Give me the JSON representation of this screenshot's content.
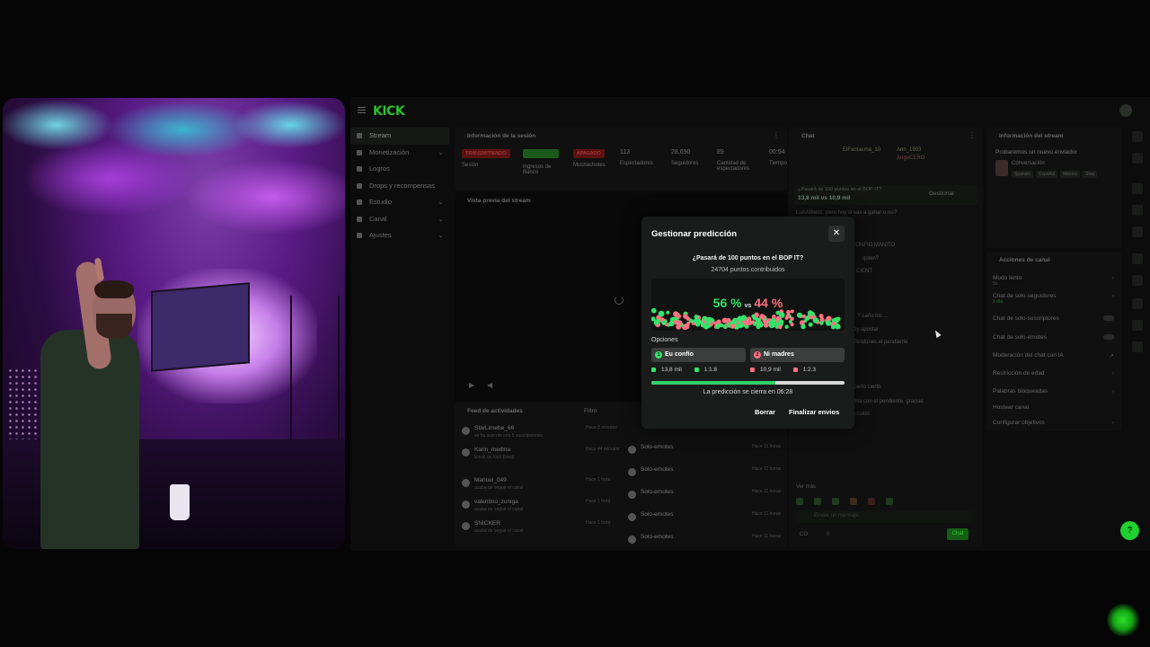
{
  "app": {
    "logo": "KICK"
  },
  "sidenav": {
    "items": [
      {
        "label": "Stream",
        "active": true,
        "chevron": false
      },
      {
        "label": "Monetización",
        "chevron": true
      },
      {
        "label": "Logros",
        "chevron": false
      },
      {
        "label": "Drops y recompensas",
        "chevron": false
      },
      {
        "label": "Estudio",
        "chevron": true
      },
      {
        "label": "Canal",
        "chevron": true
      },
      {
        "label": "Ajustes",
        "chevron": true
      }
    ],
    "chevron_glyph": "⌄"
  },
  "session": {
    "title": "Información de la sesión",
    "stats": [
      {
        "tag": "TRANSMITIENDO",
        "label": "Sesión"
      },
      {
        "tag": "",
        "label": "Ingresos de Banco"
      },
      {
        "tag": "APAGADO",
        "label": "Muchachotes"
      },
      {
        "value": "113",
        "label": "Espectadores"
      },
      {
        "value": "28,690",
        "label": "Seguidores"
      },
      {
        "value": "89",
        "label": "Cantidad de espectadores"
      },
      {
        "value": "00:54",
        "label": "Tiempo"
      }
    ]
  },
  "preview": {
    "title": "Vista previa del stream"
  },
  "feed": {
    "title": "Feed de actividades",
    "filter": "Filtro",
    "items": [
      {
        "name": "StarLimebe_66",
        "sub": "se ha suscrito con 5 suscripciones",
        "time": "Hace 8 minutos"
      },
      {
        "name": "Karin_medina",
        "sub": "Envió un Kick Emoji",
        "time": "Hace 44 minutos"
      },
      {
        "name": "Manuel_049",
        "sub": "acaba de seguir el canal",
        "time": "Hace 1 hora"
      },
      {
        "name": "valentino_zuniga",
        "sub": "acaba de seguir el canal",
        "time": "Hace 1 hora"
      },
      {
        "name": "SNICKER",
        "sub": "acaba de seguir el canal",
        "time": "Hace 1 hora"
      }
    ],
    "mods": [
      {
        "name": "Solo-emotes",
        "time": "Hace 11 horas"
      },
      {
        "name": "Solo-emotes",
        "time": "Hace 11 horas"
      },
      {
        "name": "Solo-emotes",
        "time": "Hace 11 horas"
      },
      {
        "name": "Solo-emotes",
        "time": "Hace 11 horas"
      },
      {
        "name": "Solo-emotes",
        "time": "Hace 11 horas"
      },
      {
        "name": "Solo-emotes",
        "time": ""
      }
    ]
  },
  "chat": {
    "title": "Chat",
    "top_users": [
      "ElFantasma_10",
      "Ann_1993",
      "AngeCERO"
    ],
    "prediction_banner": "¿Pasará de 100 puntos en el BOP IT?",
    "banner_left": "13,8 mil",
    "banner_right": "10,9 mil",
    "banner_vs": "vs",
    "manage": "Gestionar",
    "lines": [
      "LuisAlbetrz: pero hoy si vas a ganar o no?",
      "EU CONFIO MANITO",
      "quien?",
      "CIENT",
      "Y saño los ...",
      "oy apostar",
      "Tendones el pendiente",
      "Cierto cierto",
      "cambia con el pendiente, gracias",
      "erso cuion",
      "Ver más"
    ],
    "input_placeholder": "Enviar un mensaje",
    "counter_a": "CO",
    "counter_b": "0",
    "send": "Chat"
  },
  "stream_info": {
    "title": "Información del stream",
    "stream_title": "Probaremos un nuevo enviador",
    "category": "Conversación",
    "tags": [
      "Spanish",
      "Español",
      "México",
      "Stop"
    ]
  },
  "channel_actions": {
    "title": "Acciones de canal",
    "items": [
      {
        "label": "Modo lento",
        "sub": "5s",
        "control": "chevron"
      },
      {
        "label": "Chat de solo-seguidores",
        "sub": "1 día",
        "control": "chevron"
      },
      {
        "label": "Chat de solo-suscriptores",
        "control": "toggle"
      },
      {
        "label": "Chat de solo-emotes",
        "control": "toggle"
      },
      {
        "label": "Moderación del chat con IA",
        "control": "arrow"
      },
      {
        "label": "Restricción de edad",
        "control": "chevron"
      },
      {
        "label": "Palabras bloqueadas",
        "control": "chevron"
      },
      {
        "label": "Hostear canal",
        "control": ""
      },
      {
        "label": "Configurar objetivos",
        "control": "chevron"
      }
    ]
  },
  "modal": {
    "title": "Gestionar predicción",
    "close_glyph": "✕",
    "question": "¿Pasará de 100 puntos en el BOP IT?",
    "points": "24704 puntos contribuidos",
    "pct_yes": "56 %",
    "vs": "vs",
    "pct_no": "44 %",
    "yes_share": 0.56,
    "options_label": "Opciones",
    "options": [
      {
        "num": "1",
        "label": "Eu confío",
        "amount": "13,8 mil",
        "ratio": "1:1.8",
        "color": "#33e36a"
      },
      {
        "num": "2",
        "label": "Ni madres",
        "amount": "10,9 mil",
        "ratio": "1:2.3",
        "color": "#ff6f7f"
      }
    ],
    "time_progress": 0.64,
    "closes_text": "La predicción se cierra en 06:28",
    "delete_label": "Borrar",
    "finalize_label": "Finalizar envios"
  },
  "floating": {
    "help_glyph": "?"
  },
  "colors": {
    "accent": "#33d06a",
    "kick_green": "#53fc18",
    "danger": "#ff6f7f"
  }
}
